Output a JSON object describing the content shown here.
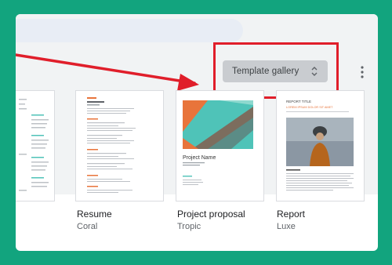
{
  "toolbar": {
    "gallery_label": "Template gallery",
    "gallery_icon": "unfold-more-icon",
    "more_icon": "more-vert-icon"
  },
  "annotation": {
    "arrow_color": "#e01e2a",
    "box_color": "#e01e2a"
  },
  "templates": [
    {
      "title": "Resume",
      "subtitle": "Coral"
    },
    {
      "title": "Project proposal",
      "subtitle": "Tropic"
    },
    {
      "title": "Report",
      "subtitle": "Luxe"
    }
  ],
  "previews": {
    "proposal_heading": "Project Name",
    "report_heading": "REPORT TITLE",
    "report_subheading": "LOREM IPSUM DOLOR SIT AMET"
  },
  "colors": {
    "background": "#12a47e",
    "accent_coral": "#e8743b",
    "accent_teal": "#4fc3b8"
  }
}
